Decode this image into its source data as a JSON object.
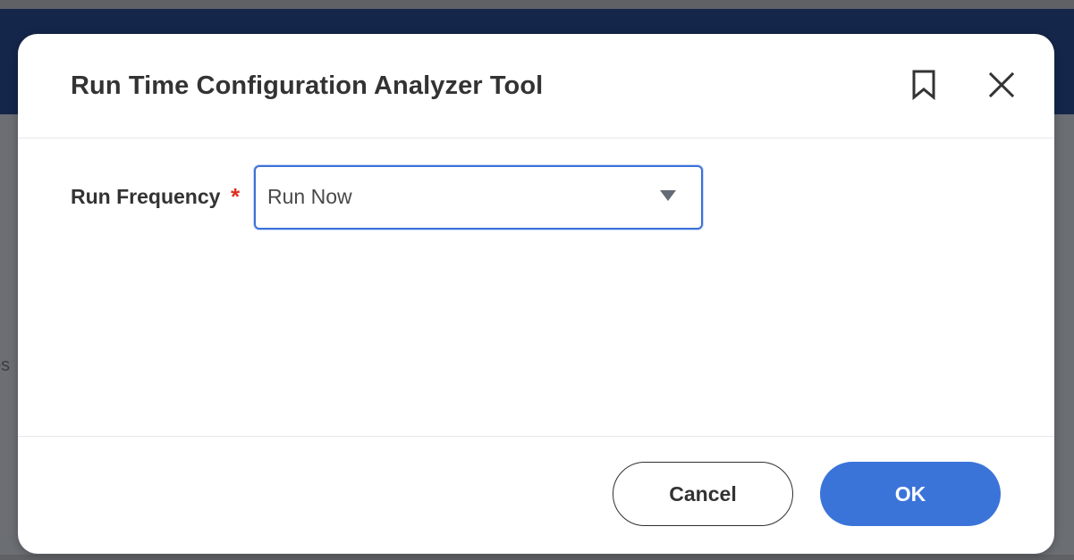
{
  "background": {
    "partial_text": "os",
    "colors": {
      "overlay": "#6b6e73",
      "header": "#14264a"
    }
  },
  "dialog": {
    "title": "Run Time Configuration Analyzer Tool",
    "icons": {
      "bookmark": "bookmark-icon",
      "close": "close-icon"
    },
    "field": {
      "label": "Run Frequency",
      "required_marker": "*",
      "value": "Run Now",
      "dropdown_icon": "caret-down-icon"
    },
    "footer": {
      "cancel_label": "Cancel",
      "ok_label": "OK"
    },
    "colors": {
      "accent": "#3b74d9",
      "required": "#de2e21",
      "title_text": "#333333"
    }
  }
}
